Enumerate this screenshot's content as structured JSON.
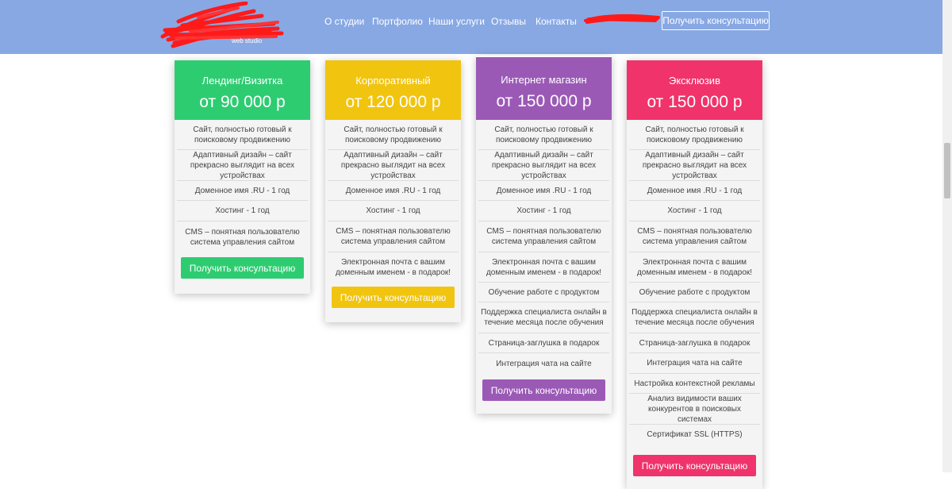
{
  "header": {
    "logo_sub": "web studio",
    "nav": [
      "О студии",
      "Портфолио",
      "Наши услуги",
      "Отзывы",
      "Контакты"
    ],
    "cta_label": "Получить консультацию",
    "bg_color": "#88a8e4"
  },
  "cards": [
    {
      "title": "Лендинг/Визитка",
      "price": "от 90 000 р",
      "color": "#2ecc71",
      "features": [
        "Сайт, полностью готовый к поисковому продвижению",
        "Адаптивный дизайн – сайт прекрасно выглядит на всех устройствах",
        "Доменное имя .RU - 1 год",
        "Хостинг - 1 год",
        "CMS – понятная пользователю система управления сайтом"
      ],
      "button": "Получить консультацию"
    },
    {
      "title": "Корпоративный",
      "price": "от 120 000 р",
      "color": "#f1c40f",
      "features": [
        "Сайт, полностью готовый к поисковому продвижению",
        "Адаптивный дизайн – сайт прекрасно выглядит на всех устройствах",
        "Доменное имя .RU - 1 год",
        "Хостинг - 1 год",
        "CMS – понятная пользователю система управления сайтом",
        "Электронная почта с вашим доменным именем - в подарок!"
      ],
      "button": "Получить консультацию"
    },
    {
      "title": "Интернет магазин",
      "price": "от 150 000 р",
      "color": "#9b59b6",
      "features": [
        "Сайт, полностью готовый к поисковому продвижению",
        "Адаптивный дизайн – сайт прекрасно выглядит на всех устройствах",
        "Доменное имя .RU - 1 год",
        "Хостинг - 1 год",
        "CMS – понятная пользователю система управления сайтом",
        "Электронная почта с вашим доменным именем - в подарок!",
        "Обучение работе с продуктом",
        "Поддержка специалиста онлайн в течение месяца после обучения",
        "Страница-заглушка в подарок",
        "Интеграция чата на сайте"
      ],
      "button": "Получить консультацию"
    },
    {
      "title": "Эксклюзив",
      "price": "от 150 000 р",
      "color": "#f0336b",
      "features": [
        "Сайт, полностью готовый к поисковому продвижению",
        "Адаптивный дизайн – сайт прекрасно выглядит на всех устройствах",
        "Доменное имя .RU - 1 год",
        "Хостинг - 1 год",
        "CMS – понятная пользователю система управления сайтом",
        "Электронная почта с вашим доменным именем - в подарок!",
        "Обучение работе с продуктом",
        "Поддержка специалиста онлайн в течение месяца после обучения",
        "Страница-заглушка в подарок",
        "Интеграция чата на сайте",
        "Настройка контекстной рекламы",
        "Анализ видимости ваших конкурентов в поисковых системах",
        "Сертификат SSL (HTTPS)"
      ],
      "button": "Получить консультацию"
    }
  ]
}
